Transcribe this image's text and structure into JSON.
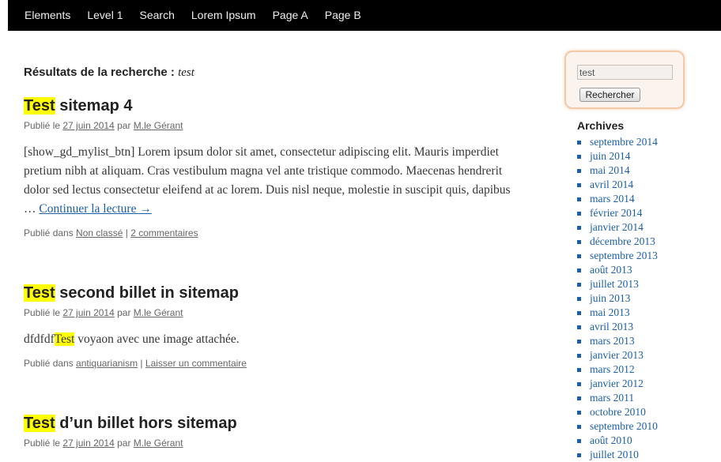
{
  "nav": [
    "Elements",
    "Level 1",
    "Search",
    "Lorem Ipsum",
    "Page A",
    "Page B"
  ],
  "search_header": {
    "label": "Résultats de la recherche : ",
    "term": "test"
  },
  "posts": [
    {
      "title_hl": "Test",
      "title_rest": " sitemap 4",
      "meta_prefix": "Publié le ",
      "date": "27 juin 2014",
      "meta_by": " par ",
      "author": "M.le Gérant",
      "excerpt": "[show_gd_mylist_btn] Lorem ipsum dolor sit amet, consectetur adipiscing elit. Mauris imperdiet pretium nibh at aliquam. Cras vestibulum magna vel ante tristique commodo. Maecenas hendrerit dolor sed lectus consectetur eleifend at ac lorem. Duis nisl neque, molestie in suscipit quis, dapibus … ",
      "more": "Continuer la lecture →",
      "footer_prefix": "Publié dans ",
      "category": "Non classé",
      "sep": " | ",
      "comments": "2 commentaires"
    },
    {
      "title_hl": "Test",
      "title_rest": " second billet in sitemap",
      "meta_prefix": "Publié le ",
      "date": "27 juin 2014",
      "meta_by": " par ",
      "author": "M.le Gérant",
      "excerpt_pre": "dfdfdf",
      "excerpt_hl": "Test",
      "excerpt_post": " voyaon avec une image attachée.",
      "footer_prefix": "Publié dans ",
      "category": "antiquarianism",
      "sep": " | ",
      "comments": "Laisser un commentaire"
    },
    {
      "title_hl": "Test",
      "title_rest": " d’un billet hors sitemap",
      "meta_prefix": "Publié le ",
      "date": "27 juin 2014",
      "meta_by": " par ",
      "author": "M.le Gérant"
    }
  ],
  "search": {
    "value": "test",
    "button": "Rechercher"
  },
  "archives": {
    "title": "Archives",
    "items": [
      "septembre 2014",
      "juin 2014",
      "mai 2014",
      "avril 2014",
      "mars 2014",
      "février 2014",
      "janvier 2014",
      "décembre 2013",
      "septembre 2013",
      "août 2013",
      "juillet 2013",
      "juin 2013",
      "mai 2013",
      "avril 2013",
      "mars 2013",
      "janvier 2013",
      "mars 2012",
      "janvier 2012",
      "mars 2011",
      "octobre 2010",
      "septembre 2010",
      "août 2010",
      "juillet 2010"
    ]
  },
  "colors": {
    "highlight": "#ffff00",
    "link": "#1b5faa",
    "nav_bg": "#000000"
  }
}
